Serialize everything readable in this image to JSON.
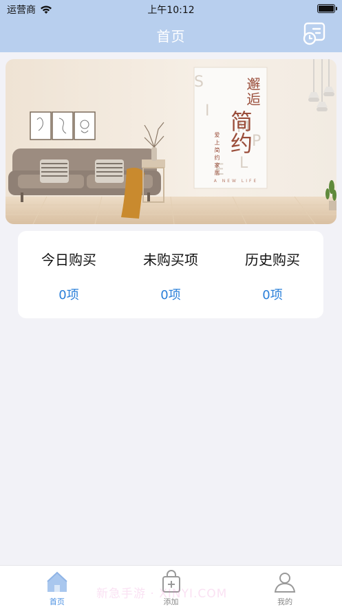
{
  "status": {
    "carrier": "运营商",
    "time": "上午10:12"
  },
  "nav": {
    "title": "首页",
    "right_icon": "record-list-icon"
  },
  "banner": {
    "poster_title1": "邂逅",
    "poster_title2": "简约",
    "poster_sub": "爱上简约家居",
    "poster_foot": "A NEW LIFE",
    "poster_letters": "SIMPLE"
  },
  "stats": [
    {
      "label": "今日购买",
      "value": "0项"
    },
    {
      "label": "未购买项",
      "value": "0项"
    },
    {
      "label": "历史购买",
      "value": "0项"
    }
  ],
  "tabs": [
    {
      "label": "首页",
      "icon": "home-icon",
      "active": true
    },
    {
      "label": "添加",
      "icon": "add-bag-icon",
      "active": false
    },
    {
      "label": "我的",
      "icon": "user-icon",
      "active": false
    }
  ],
  "watermark": "新急手游 · XINYI.COM",
  "colors": {
    "nav_bg": "#b8cfee",
    "accent": "#2a7fd9",
    "tab_active": "#4a90e2"
  }
}
